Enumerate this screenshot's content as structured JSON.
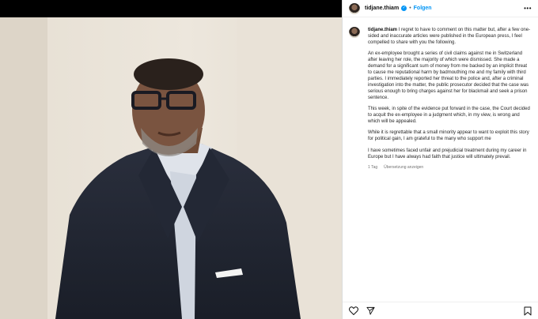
{
  "header": {
    "username": "tidjane.thiam",
    "separator": "•",
    "follow_label": "Folgen",
    "more_label": "•••"
  },
  "post": {
    "username": "tidjane.thiam",
    "paragraphs": [
      "I regret to have to comment on this matter but, after a few one-sided and inaccurate articles were published in the European press, I feel compelled to share with you the following.",
      "An ex-employee brought a series of civil claims against me in Switzerland after leaving her role, the majority of which were dismissed. She made a demand for a significant sum of money from me backed by an implicit threat to cause me reputational harm by badmouthing me and my family with third parties. I immediately reported her threat to the police and, after a criminal investigation into the matter, the public prosecutor decided that the case was serious enough to bring charges against her for blackmail and seek a prison sentence.",
      "This week, in spite of the evidence put forward in the case, the Court decided to acquit the ex-employee in a judgment which, in my view, is wrong and which will be appealed.",
      "While it is regrettable that a small minority appear to want to exploit this story for political gain, I am grateful to the many who support me",
      "I have sometimes faced unfair and prejudicial treatment during my career in Europe but I have always had faith that justice will ultimately prevail."
    ],
    "age": "1 Tag",
    "translate_label": "Übersetzung anzeigen"
  },
  "icons": {
    "like": "heart-icon",
    "share": "paper-plane-icon",
    "save": "bookmark-icon",
    "verified": "verified-badge-icon"
  },
  "colors": {
    "accent": "#0095f6",
    "text": "#262626",
    "muted": "#737373"
  }
}
